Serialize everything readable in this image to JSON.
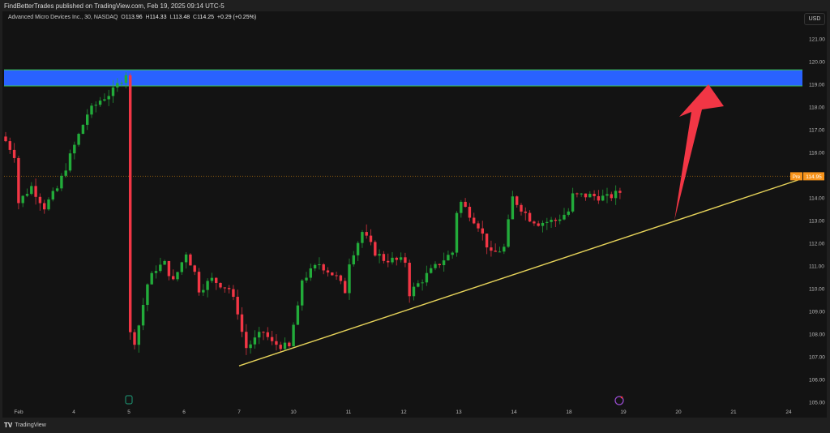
{
  "header": {
    "published": "FindBetterTrades published on TradingView.com, Feb 19, 2025 09:14 UTC-5",
    "symbol": "Advanced Micro Devices Inc., 30, NASDAQ",
    "open_label": "O",
    "open": "113.96",
    "high_label": "H",
    "high": "114.33",
    "low_label": "L",
    "low": "113.48",
    "close_label": "C",
    "close": "114.25",
    "change": "+0.29 (+0.25%)"
  },
  "currency": "USD",
  "footer": {
    "logo": "TV",
    "brand": "TradingView"
  },
  "colors": {
    "up": "#22ab3a",
    "down": "#f23645",
    "zone": "#2962ff",
    "trendline": "#e6d35a",
    "arrow": "#f23645",
    "pre": "#f7931a"
  },
  "chart_data": {
    "type": "candlestick",
    "interval": "30",
    "y_ticks": [
      "121.00",
      "120.00",
      "119.00",
      "118.00",
      "117.00",
      "116.00",
      "115.00",
      "114.00",
      "113.00",
      "112.00",
      "111.00",
      "110.00",
      "109.00",
      "108.00",
      "107.00",
      "106.00",
      "105.00"
    ],
    "ylim": [
      105,
      121
    ],
    "x_ticks": [
      "Feb",
      "4",
      "5",
      "6",
      "7",
      "10",
      "11",
      "12",
      "13",
      "14",
      "18",
      "19",
      "20",
      "21",
      "24"
    ],
    "price_path": [
      [
        0,
        116.5
      ],
      [
        2,
        115.9
      ],
      [
        3,
        113.8
      ],
      [
        6,
        114.5
      ],
      [
        9,
        113.6
      ],
      [
        12,
        114.4
      ],
      [
        16,
        116.3
      ],
      [
        19,
        117.7
      ],
      [
        22,
        118.3
      ],
      [
        25,
        118.7
      ],
      [
        28,
        119.5
      ],
      [
        29,
        108.0
      ],
      [
        30,
        107.7
      ],
      [
        31,
        108.4
      ],
      [
        33,
        110.2
      ],
      [
        35,
        110.9
      ],
      [
        37,
        111.1
      ],
      [
        39,
        110.3
      ],
      [
        42,
        111.6
      ],
      [
        44,
        110.7
      ],
      [
        44.5,
        109.9
      ],
      [
        48,
        110.4
      ],
      [
        52,
        110.0
      ],
      [
        54,
        109.0
      ],
      [
        55,
        108.1
      ],
      [
        56,
        107.4
      ],
      [
        60,
        108.1
      ],
      [
        62,
        107.6
      ],
      [
        66,
        107.4
      ],
      [
        67,
        108.4
      ],
      [
        68,
        109.1
      ],
      [
        69,
        110.4
      ],
      [
        73,
        111.1
      ],
      [
        77,
        110.5
      ],
      [
        79,
        109.9
      ],
      [
        80,
        111.2
      ],
      [
        83,
        112.5
      ],
      [
        86,
        111.6
      ],
      [
        88,
        111.3
      ],
      [
        93,
        111.2
      ],
      [
        93.5,
        109.7
      ],
      [
        98,
        110.6
      ],
      [
        102,
        111.3
      ],
      [
        104,
        111.6
      ],
      [
        105,
        113.4
      ],
      [
        106,
        113.8
      ],
      [
        110,
        112.8
      ],
      [
        113,
        111.5
      ],
      [
        116,
        111.8
      ],
      [
        118,
        114.0
      ],
      [
        122,
        113.1
      ],
      [
        124,
        112.9
      ],
      [
        128,
        113.0
      ],
      [
        131,
        113.4
      ],
      [
        132,
        114.1
      ],
      [
        136,
        114.1
      ],
      [
        140,
        114.0
      ],
      [
        143,
        114.25
      ]
    ],
    "preprice_label": "Pre",
    "preprice": "114.95",
    "supply_zone": [
      118.93,
      119.64
    ],
    "trendline": {
      "start": [
        "7",
        106.6
      ],
      "end": [
        "24",
        114.79
      ]
    },
    "arrow_target": 119.0
  }
}
